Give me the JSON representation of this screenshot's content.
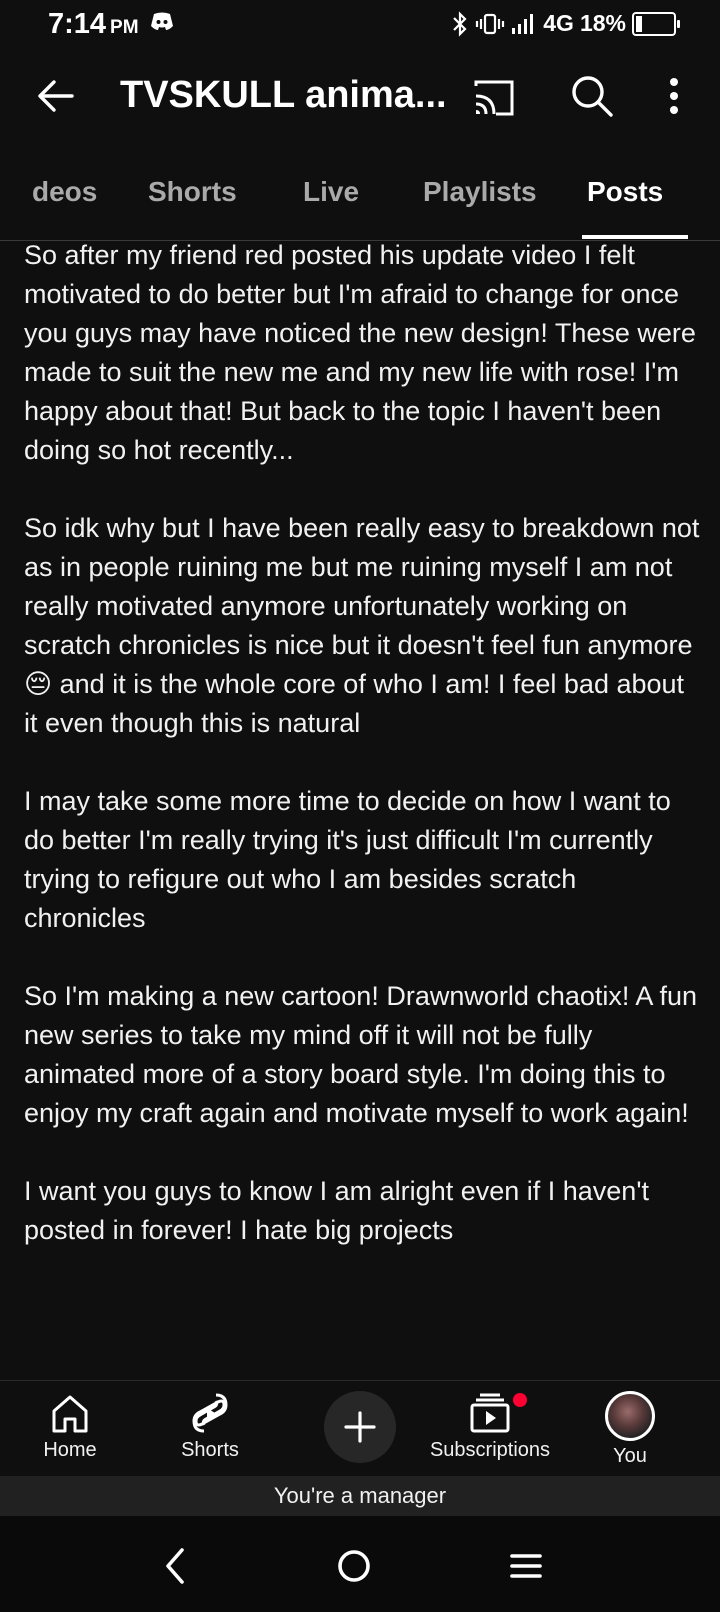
{
  "status_bar": {
    "time": "7:14",
    "ampm": "PM",
    "network": "4G",
    "battery": "18%",
    "icons": [
      "discord-icon",
      "bluetooth-icon",
      "vibrate-icon",
      "signal-icon",
      "battery-icon"
    ]
  },
  "app_bar": {
    "title": "TVSKULL anima...",
    "icons": [
      "back-arrow-icon",
      "cast-icon",
      "search-icon",
      "more-vert-icon"
    ]
  },
  "tabs": [
    {
      "label": "deos",
      "active": false
    },
    {
      "label": "Shorts",
      "active": false
    },
    {
      "label": "Live",
      "active": false
    },
    {
      "label": "Playlists",
      "active": false
    },
    {
      "label": "Posts",
      "active": true
    }
  ],
  "post": {
    "paragraphs": [
      "So after my friend red posted his update video I felt motivated to do better but I'm afraid to change for once you guys may have noticed the new design! These were made to suit the new me and my new life with rose! I'm happy about that! But back to the topic I haven't been doing so hot recently...",
      "So idk why but I have been really easy to breakdown not as in people ruining me but me ruining myself I am not really motivated anymore unfortunately working on scratch chronicles is nice but it doesn't feel fun anymore 😔 and it is the whole core of who I am! I feel bad about it even though this is natural",
      "I may take some more time to decide on how I want to do better I'm really trying it's just difficult I'm currently trying to refigure out who I am besides scratch chronicles",
      "So I'm making a new cartoon! Drawnworld chaotix! A fun new series to take my mind off it will not be fully animated more of a story board style. I'm doing this to enjoy my craft again and motivate myself to work again!",
      "I want you guys to know I am alright even if I haven't posted in forever! I hate big projects"
    ]
  },
  "bottom_nav": {
    "items": [
      {
        "label": "Home",
        "icon": "home-icon"
      },
      {
        "label": "Shorts",
        "icon": "shorts-icon"
      },
      {
        "label": "",
        "icon": "create-plus-icon"
      },
      {
        "label": "Subscriptions",
        "icon": "subscriptions-icon"
      },
      {
        "label": "You",
        "icon": "avatar"
      }
    ]
  },
  "manager_banner": "You're a manager",
  "colors": {
    "background": "#0f0f0f",
    "text": "#f1f1f1",
    "inactive_tab": "#aaaaaa",
    "notification": "#ff0033",
    "create_button": "#272727"
  }
}
